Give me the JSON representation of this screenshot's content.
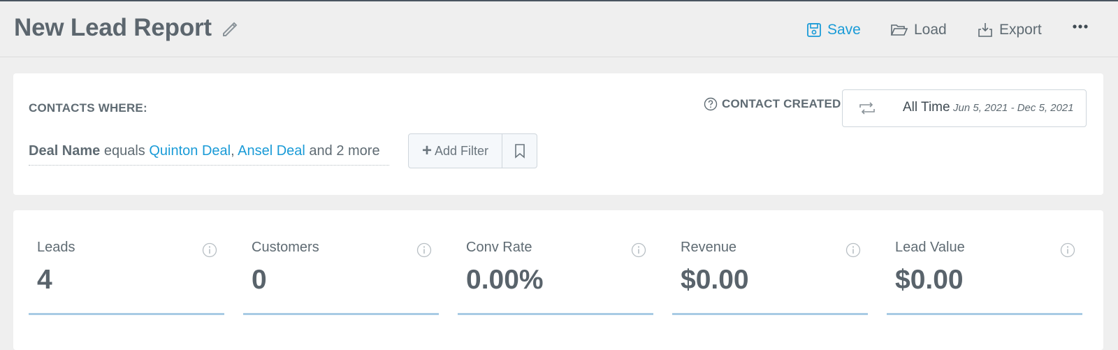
{
  "header": {
    "title": "New Lead Report",
    "actions": {
      "save": "Save",
      "load": "Load",
      "export": "Export"
    },
    "icons": [
      "pencil-icon",
      "save-icon",
      "folder-open-icon",
      "export-icon",
      "more-horizontal-icon"
    ],
    "accent_color": "#1a9bd7"
  },
  "filters": {
    "heading": "CONTACTS WHERE:",
    "date_filter_label": "CONTACT CREATED",
    "date_option": "All Time",
    "date_range": "Jun 5, 2021 - Dec 5, 2021",
    "condition": {
      "field": "Deal Name",
      "operator": "equals",
      "value1": "Quinton Deal",
      "separator": ",",
      "value2": "Ansel Deal",
      "more": "and 2 more"
    },
    "add_filter_label": "Add Filter"
  },
  "stats": [
    {
      "label": "Leads",
      "value": "4"
    },
    {
      "label": "Customers",
      "value": "0"
    },
    {
      "label": "Conv Rate",
      "value": "0.00%"
    },
    {
      "label": "Revenue",
      "value": "$0.00"
    },
    {
      "label": "Lead Value",
      "value": "$0.00"
    }
  ]
}
